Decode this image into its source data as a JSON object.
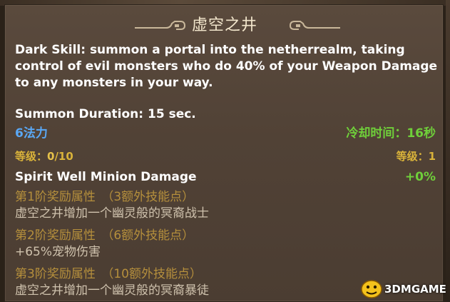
{
  "skill": {
    "title": "虚空之井",
    "description": "Dark Skill: summon a portal into the netherrealm, taking control of evil monsters who do 40% of your Weapon Damage to any monsters in your way.",
    "summon_duration": "Summon Duration: 15 sec.",
    "mana_cost": "6法力",
    "cooldown": "冷却时间：16秒",
    "level_left_label": "等级：",
    "level_left_value": "0",
    "level_left_max": "/10",
    "level_right": "等级：1",
    "stat_name": "Spirit Well Minion Damage",
    "stat_value": "+0%"
  },
  "bonuses": [
    {
      "heading": "第1阶奖励属性　（3额外技能点）",
      "effect": "虚空之井增加一个幽灵般的冥裔战士"
    },
    {
      "heading": "第2阶奖励属性　（6额外技能点）",
      "effect": "+65%宠物伤害"
    },
    {
      "heading": "第3阶奖励属性　（10额外技能点）",
      "effect": "虚空之井增加一个幽灵般的冥裔暴徒"
    }
  ],
  "watermark": "3DMGAME",
  "colors": {
    "panel": "#514236",
    "title": "#f2e6cc",
    "mana": "#5aa8f5",
    "cooldown": "#6fcf3a",
    "level": "#d9b33a",
    "bonus_heading": "#b58f3c",
    "bonus_effect": "#cfc2ad"
  }
}
